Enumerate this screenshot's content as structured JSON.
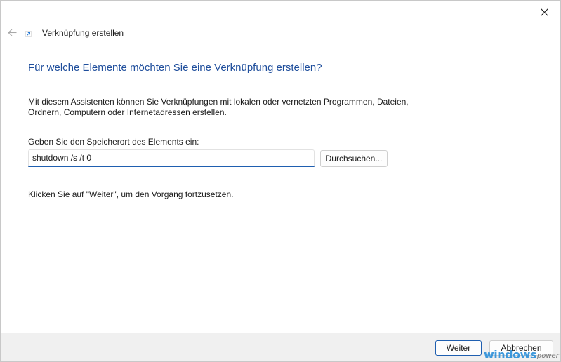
{
  "window": {
    "title": "Verknüpfung erstellen",
    "icons": {
      "back": "back-arrow-icon",
      "close": "close-icon",
      "app": "shortcut-icon"
    }
  },
  "main": {
    "heading": "Für welche Elemente möchten Sie eine Verknüpfung erstellen?",
    "description": "Mit diesem Assistenten können Sie Verknüpfungen mit lokalen oder vernetzten Programmen, Dateien, Ordnern, Computern oder Internetadressen erstellen.",
    "location_label": "Geben Sie den Speicherort des Elements ein:",
    "location_value": "shutdown /s /t 0",
    "browse_label": "Durchsuchen...",
    "hint": "Klicken Sie auf \"Weiter\", um den Vorgang fortzusetzen."
  },
  "footer": {
    "next_label": "Weiter",
    "cancel_label": "Abbrechen"
  },
  "watermark": {
    "main": "windows",
    "sub": "power"
  },
  "colors": {
    "heading": "#1f4e9c",
    "accent": "#1f5fb0",
    "footer_bg": "#f0f0f0",
    "watermark": "#2b8fd9"
  }
}
